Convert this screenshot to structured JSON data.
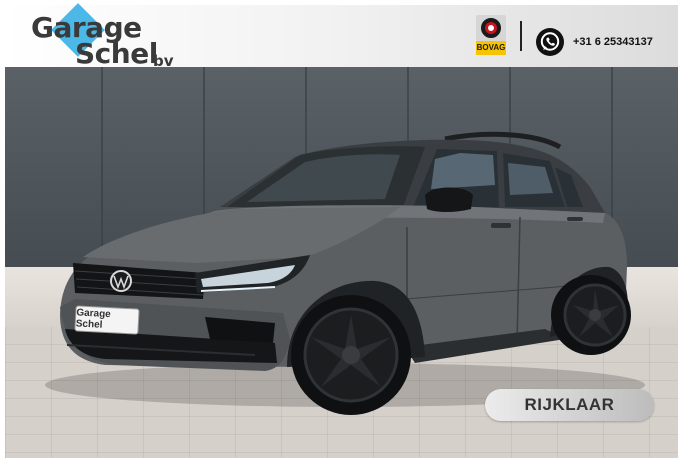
{
  "header": {
    "logo": {
      "line1": "Garage",
      "line2": "Schel",
      "suffix": "bv"
    },
    "bovag_label": "BOVAG",
    "whatsapp_icon": "whatsapp-icon",
    "phone": "+31 6 25343137"
  },
  "photo": {
    "plate_text": "Garage Schel",
    "badge": "RIJKLAAR"
  },
  "colors": {
    "accent": "#4cb8e8",
    "car_body": "#5b5f62",
    "wall": "#50575d",
    "pavement": "#d6d0ca"
  }
}
